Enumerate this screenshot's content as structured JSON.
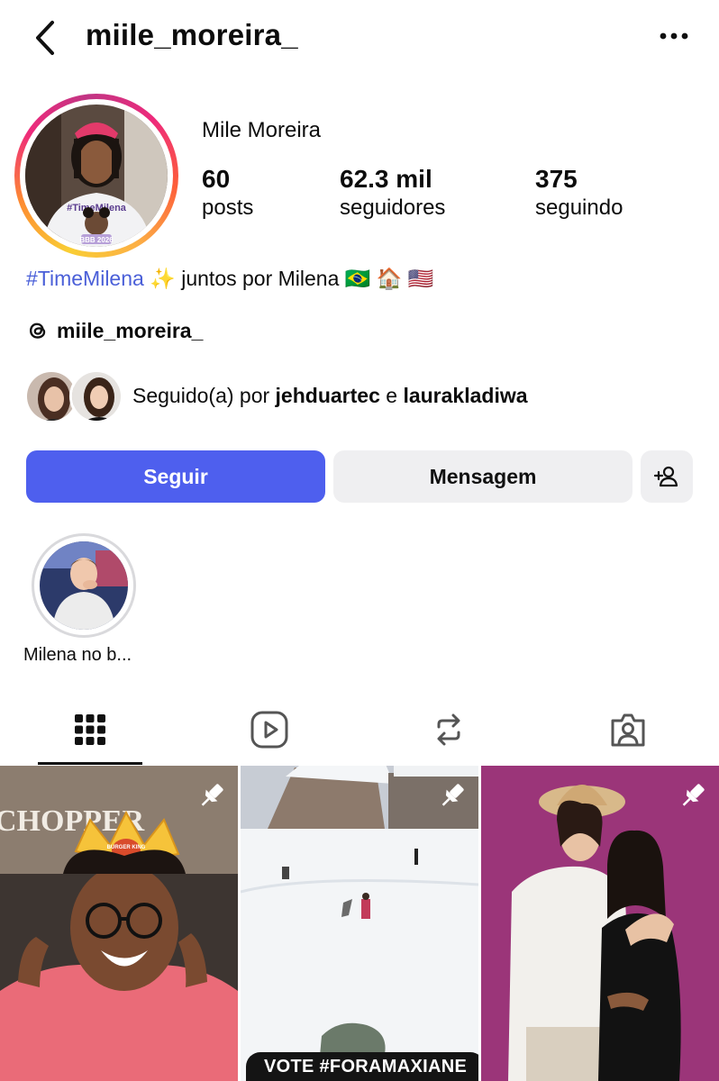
{
  "header": {
    "username": "miile_moreira_"
  },
  "profile": {
    "full_name": "Mile Moreira",
    "stats": [
      {
        "value": "60",
        "label": "posts"
      },
      {
        "value": "62.3 mil",
        "label": "seguidores"
      },
      {
        "value": "375",
        "label": "seguindo"
      }
    ],
    "bio_hashtag": "#TimeMilena",
    "bio_text": "✨ juntos por Milena 🇧🇷 🏠 🇺🇸",
    "threads_handle": "miile_moreira_",
    "avatar_shirt_text": "#TimeMilena",
    "avatar_badge": "BBB 2026"
  },
  "followed_by": {
    "prefix": "Seguido(a) por",
    "user1": "jehduartec",
    "conj": "e",
    "user2": "laurakladiwa"
  },
  "actions": {
    "follow": "Seguir",
    "message": "Mensagem"
  },
  "highlights": [
    {
      "label": "Milena no b..."
    }
  ],
  "tabs": [
    {
      "name": "grid",
      "icon": "grid-icon",
      "active": true
    },
    {
      "name": "reels",
      "icon": "reels-icon",
      "active": false
    },
    {
      "name": "reposts",
      "icon": "repost-icon",
      "active": false
    },
    {
      "name": "tagged",
      "icon": "tagged-icon",
      "active": false
    }
  ],
  "posts": [
    {
      "pinned": true,
      "sign_text": "CHOPPER",
      "crown_text": "BURGER KING"
    },
    {
      "pinned": true
    },
    {
      "pinned": true,
      "overlay_text": "VOTE #FORAMAXIANE"
    }
  ],
  "colors": {
    "accent": "#4e5fee",
    "hashtag": "#4a5fd8",
    "button_gray": "#efeff1"
  }
}
